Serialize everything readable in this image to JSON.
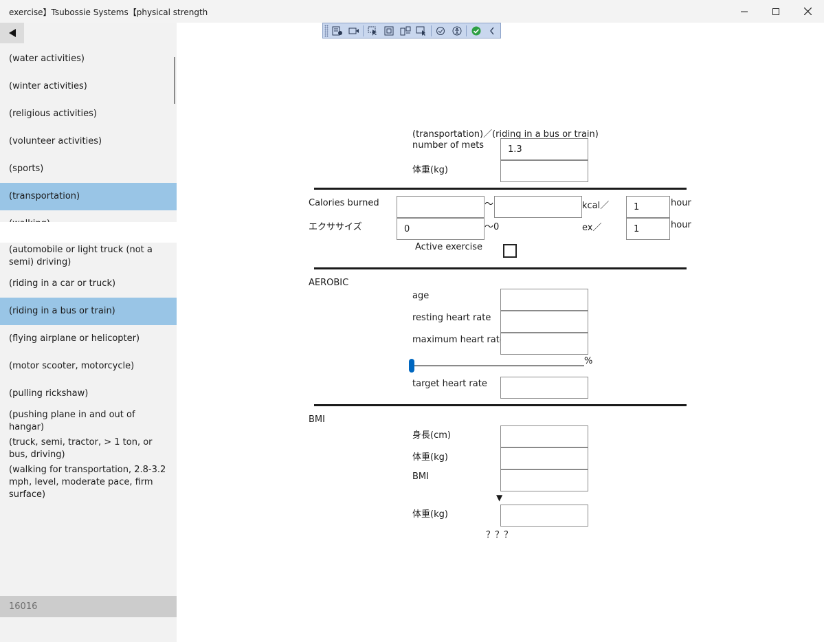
{
  "window": {
    "title": "exercise】Tsubossie Systems【physical strength"
  },
  "sidebar": {
    "categories": [
      "(water activities)",
      "(winter activities)",
      "(religious activities)",
      "(volunteer activities)",
      "(sports)",
      "(transportation)",
      "(walking)"
    ],
    "activities": [
      "(automobile or light truck (not a semi) driving)",
      "(riding in a car or truck)",
      "(riding in a bus or train)",
      "(flying airplane or helicopter)",
      "(motor scooter, motorcycle)",
      "(pulling rickshaw)",
      "(pushing plane in and out of hangar)",
      "(truck, semi, tractor, > 1 ton, or bus, driving)",
      "(walking for transportation, 2.8-3.2 mph, level, moderate pace, firm surface)"
    ],
    "status_code": "16016"
  },
  "form": {
    "heading": "(transportation)／(riding in a bus or train)",
    "mets_label": "number of mets",
    "mets_value": "1.3",
    "weight_label": "体重(kg)",
    "calories_label": "Calories burned",
    "tilde": "～",
    "kcal_unit": "kcal／",
    "hours_value": "1",
    "hour_unit": "hour",
    "exercise_label": "エクササイズ",
    "exercise_value": "0",
    "exercise_range_end": "～0",
    "ex_unit": "ex／",
    "active_label": "Active exercise",
    "aerobic_label": "AEROBIC",
    "age_label": "age",
    "resting_label": "resting heart rate",
    "max_label": "maximum heart rate",
    "percent_sign": "%",
    "slider_fraction": 0,
    "target_label": "target heart rate",
    "bmi_section": "BMI",
    "height_label": "身長(cm)",
    "bmi_label": "BMI",
    "down_arrow": "▼",
    "question": "？？？"
  }
}
